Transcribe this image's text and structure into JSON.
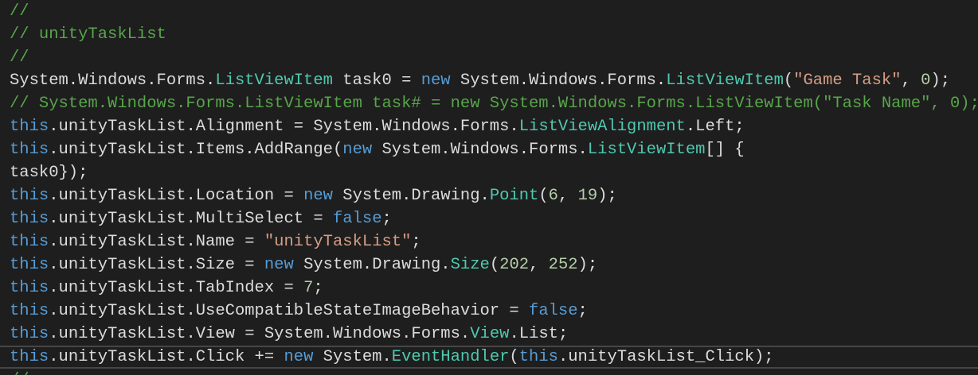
{
  "editor": {
    "current_line_index": 15,
    "colors": {
      "background": "#1e1e1e",
      "plain": "#dcdcdc",
      "keyword": "#569cd6",
      "type": "#4ec9b0",
      "string": "#d69d85",
      "comment": "#57a64a",
      "number": "#b5cea8"
    },
    "lines": [
      {
        "tokens": [
          {
            "t": "//",
            "c": "cm"
          }
        ]
      },
      {
        "tokens": [
          {
            "t": "// unityTaskList",
            "c": "cm"
          }
        ]
      },
      {
        "tokens": [
          {
            "t": "//",
            "c": "cm"
          }
        ]
      },
      {
        "tokens": [
          {
            "t": "System.Windows.Forms.",
            "c": "pl"
          },
          {
            "t": "ListViewItem",
            "c": "ty"
          },
          {
            "t": " task0 = ",
            "c": "pl"
          },
          {
            "t": "new",
            "c": "kw"
          },
          {
            "t": " System.Windows.Forms.",
            "c": "pl"
          },
          {
            "t": "ListViewItem",
            "c": "ty"
          },
          {
            "t": "(",
            "c": "pl"
          },
          {
            "t": "\"Game Task\"",
            "c": "str"
          },
          {
            "t": ", ",
            "c": "pl"
          },
          {
            "t": "0",
            "c": "num"
          },
          {
            "t": ");",
            "c": "pl"
          }
        ]
      },
      {
        "tokens": [
          {
            "t": "// System.Windows.Forms.ListViewItem task# = new System.Windows.Forms.ListViewItem(\"Task Name\", 0);",
            "c": "cm"
          }
        ]
      },
      {
        "tokens": [
          {
            "t": "this",
            "c": "kw"
          },
          {
            "t": ".unityTaskList.Alignment = System.Windows.Forms.",
            "c": "pl"
          },
          {
            "t": "ListViewAlignment",
            "c": "ty"
          },
          {
            "t": ".Left;",
            "c": "pl"
          }
        ]
      },
      {
        "tokens": [
          {
            "t": "this",
            "c": "kw"
          },
          {
            "t": ".unityTaskList.Items.AddRange(",
            "c": "pl"
          },
          {
            "t": "new",
            "c": "kw"
          },
          {
            "t": " System.Windows.Forms.",
            "c": "pl"
          },
          {
            "t": "ListViewItem",
            "c": "ty"
          },
          {
            "t": "[] {",
            "c": "pl"
          }
        ]
      },
      {
        "tokens": [
          {
            "t": "task0});",
            "c": "pl"
          }
        ]
      },
      {
        "tokens": [
          {
            "t": "this",
            "c": "kw"
          },
          {
            "t": ".unityTaskList.Location = ",
            "c": "pl"
          },
          {
            "t": "new",
            "c": "kw"
          },
          {
            "t": " System.Drawing.",
            "c": "pl"
          },
          {
            "t": "Point",
            "c": "ty"
          },
          {
            "t": "(",
            "c": "pl"
          },
          {
            "t": "6",
            "c": "num"
          },
          {
            "t": ", ",
            "c": "pl"
          },
          {
            "t": "19",
            "c": "num"
          },
          {
            "t": ");",
            "c": "pl"
          }
        ]
      },
      {
        "tokens": [
          {
            "t": "this",
            "c": "kw"
          },
          {
            "t": ".unityTaskList.MultiSelect = ",
            "c": "pl"
          },
          {
            "t": "false",
            "c": "kw"
          },
          {
            "t": ";",
            "c": "pl"
          }
        ]
      },
      {
        "tokens": [
          {
            "t": "this",
            "c": "kw"
          },
          {
            "t": ".unityTaskList.Name = ",
            "c": "pl"
          },
          {
            "t": "\"unityTaskList\"",
            "c": "str"
          },
          {
            "t": ";",
            "c": "pl"
          }
        ]
      },
      {
        "tokens": [
          {
            "t": "this",
            "c": "kw"
          },
          {
            "t": ".unityTaskList.Size = ",
            "c": "pl"
          },
          {
            "t": "new",
            "c": "kw"
          },
          {
            "t": " System.Drawing.",
            "c": "pl"
          },
          {
            "t": "Size",
            "c": "ty"
          },
          {
            "t": "(",
            "c": "pl"
          },
          {
            "t": "202",
            "c": "num"
          },
          {
            "t": ", ",
            "c": "pl"
          },
          {
            "t": "252",
            "c": "num"
          },
          {
            "t": ");",
            "c": "pl"
          }
        ]
      },
      {
        "tokens": [
          {
            "t": "this",
            "c": "kw"
          },
          {
            "t": ".unityTaskList.TabIndex = ",
            "c": "pl"
          },
          {
            "t": "7",
            "c": "num"
          },
          {
            "t": ";",
            "c": "pl"
          }
        ]
      },
      {
        "tokens": [
          {
            "t": "this",
            "c": "kw"
          },
          {
            "t": ".unityTaskList.UseCompatibleStateImageBehavior = ",
            "c": "pl"
          },
          {
            "t": "false",
            "c": "kw"
          },
          {
            "t": ";",
            "c": "pl"
          }
        ]
      },
      {
        "tokens": [
          {
            "t": "this",
            "c": "kw"
          },
          {
            "t": ".unityTaskList.View = System.Windows.Forms.",
            "c": "pl"
          },
          {
            "t": "View",
            "c": "ty"
          },
          {
            "t": ".List;",
            "c": "pl"
          }
        ]
      },
      {
        "tokens": [
          {
            "t": "this",
            "c": "kw"
          },
          {
            "t": ".unityTaskList.Click += ",
            "c": "pl"
          },
          {
            "t": "new",
            "c": "kw"
          },
          {
            "t": " System.",
            "c": "pl"
          },
          {
            "t": "EventHandler",
            "c": "ty"
          },
          {
            "t": "(",
            "c": "pl"
          },
          {
            "t": "this",
            "c": "kw"
          },
          {
            "t": ".unityTaskList_Click);",
            "c": "pl"
          }
        ]
      },
      {
        "tokens": [
          {
            "t": "//",
            "c": "cm"
          }
        ]
      }
    ]
  }
}
